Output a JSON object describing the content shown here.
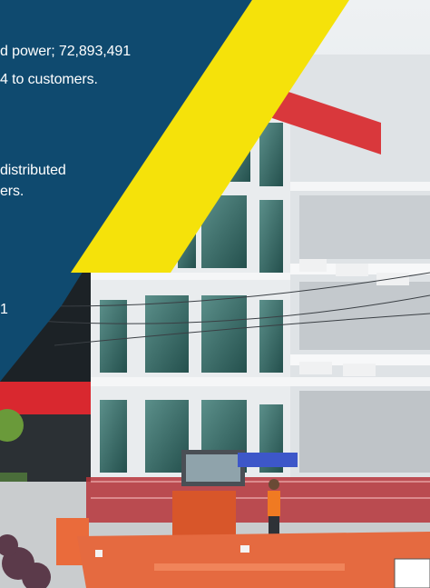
{
  "hero": {
    "lines": [
      "d power; 72,893,491",
      "4 to customers.",
      "distributed",
      "ers.",
      "1"
    ]
  },
  "colors": {
    "panel": "#0f4a6f",
    "stripe": "#f5e20a",
    "accent_red": "#d9282f",
    "barrier_orange": "#e8704a",
    "sky": "#f2f4f5"
  }
}
